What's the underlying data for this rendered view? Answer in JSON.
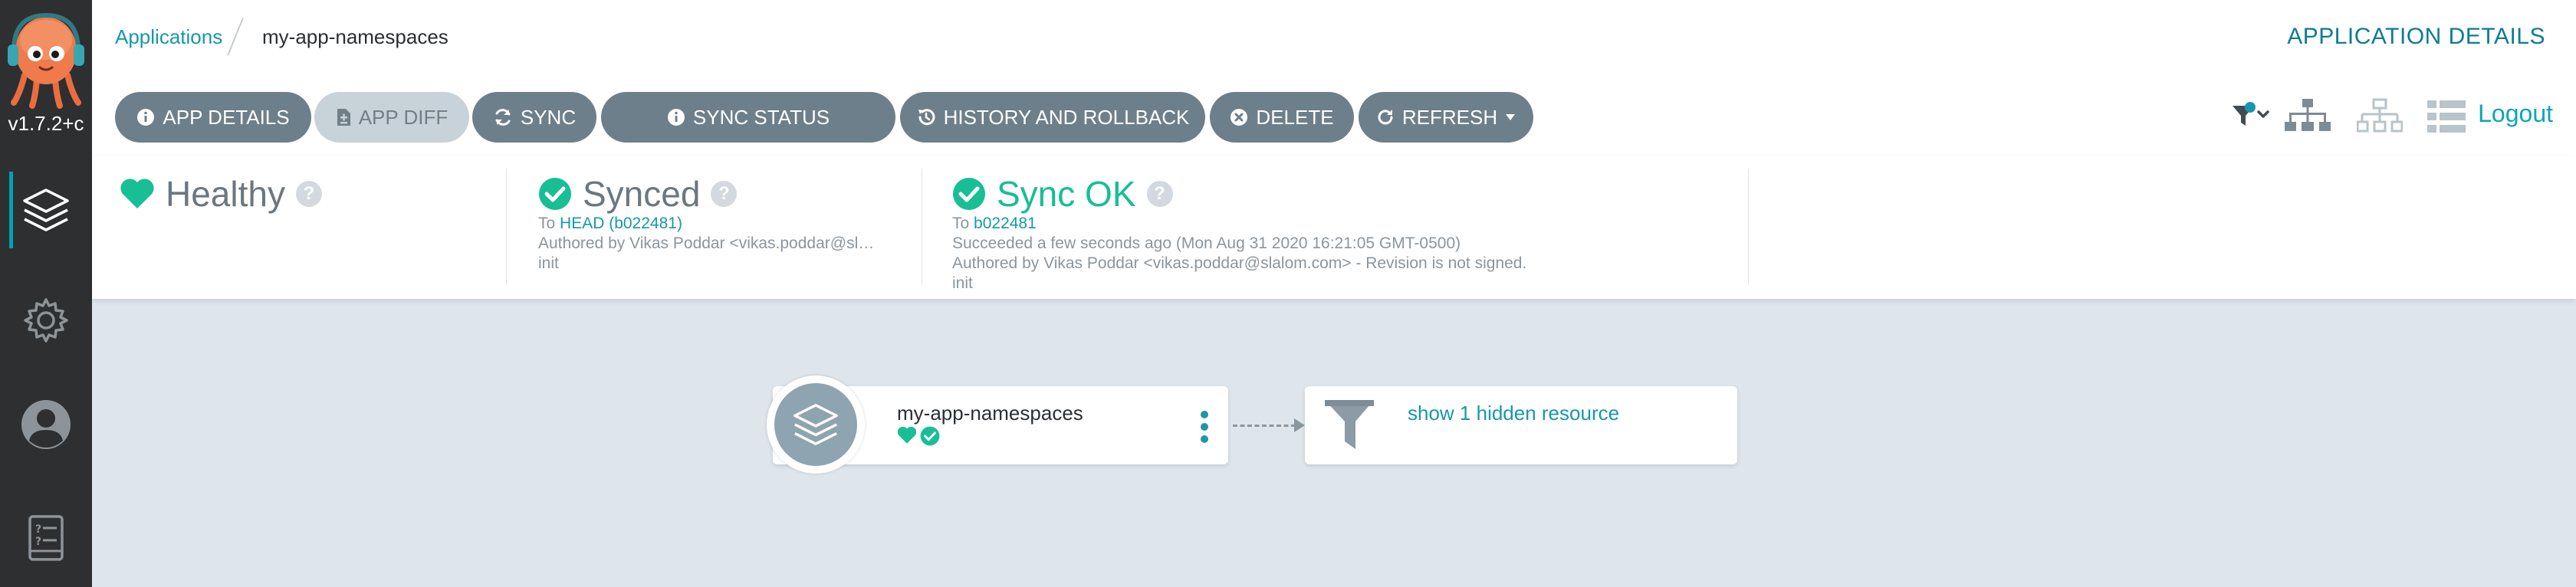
{
  "sidebar": {
    "version": "v1.7.2+c",
    "logo_icon": "argo-mascot-icon",
    "items": [
      {
        "icon": "layers-icon",
        "active": true
      },
      {
        "icon": "gear-icon",
        "active": false
      },
      {
        "icon": "user-icon",
        "active": false
      },
      {
        "icon": "docs-icon",
        "active": false
      }
    ]
  },
  "breadcrumb": {
    "parent": "Applications",
    "current": "my-app-namespaces"
  },
  "header": {
    "title": "APPLICATION DETAILS"
  },
  "toolbar": {
    "buttons": {
      "app_details": "APP DETAILS",
      "app_diff": "APP DIFF",
      "sync": "SYNC",
      "sync_status": "SYNC STATUS",
      "history": "HISTORY AND ROLLBACK",
      "delete": "DELETE",
      "refresh": "REFRESH"
    },
    "logout": "Logout"
  },
  "status": {
    "health": {
      "label": "Healthy"
    },
    "sync": {
      "label": "Synced",
      "to_prefix": "To",
      "revision": "HEAD (b022481)",
      "author": "Authored by Vikas Poddar <vikas.poddar@sl…",
      "message": "init"
    },
    "operation": {
      "label": "Sync OK",
      "to_prefix": "To",
      "revision": "b022481",
      "succeeded": "Succeeded a few seconds ago (Mon Aug 31 2020 16:21:05 GMT-0500)",
      "author": "Authored by Vikas Poddar <vikas.poddar@slalom.com> - Revision is not signed.",
      "message": "init"
    }
  },
  "graph": {
    "app_node": {
      "name": "my-app-namespaces"
    },
    "hidden": {
      "label": "show 1 hidden resource"
    }
  },
  "colors": {
    "accent": "#1697ad",
    "healthy": "#18be94",
    "sidebar": "#2d2f30",
    "button": "#6d7f8b",
    "background": "#dee6eb"
  }
}
